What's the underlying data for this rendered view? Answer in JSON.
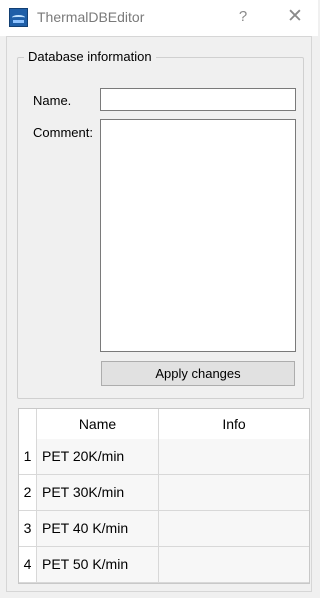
{
  "window": {
    "title": "ThermalDBEditor",
    "help_label": "?",
    "close_label": "✕",
    "icon": "app-icon"
  },
  "database_info": {
    "group_title": "Database information",
    "name_label": "Name.",
    "name_value": "",
    "comment_label": "Comment:",
    "comment_value": "",
    "apply_button": "Apply changes"
  },
  "table": {
    "columns": [
      "Name",
      "Info"
    ],
    "rows": [
      {
        "index": "1",
        "name": "PET 20K/min",
        "info": ""
      },
      {
        "index": "2",
        "name": "PET 30K/min",
        "info": ""
      },
      {
        "index": "3",
        "name": "PET 40 K/min",
        "info": ""
      },
      {
        "index": "4",
        "name": "PET 50 K/min",
        "info": ""
      }
    ]
  }
}
